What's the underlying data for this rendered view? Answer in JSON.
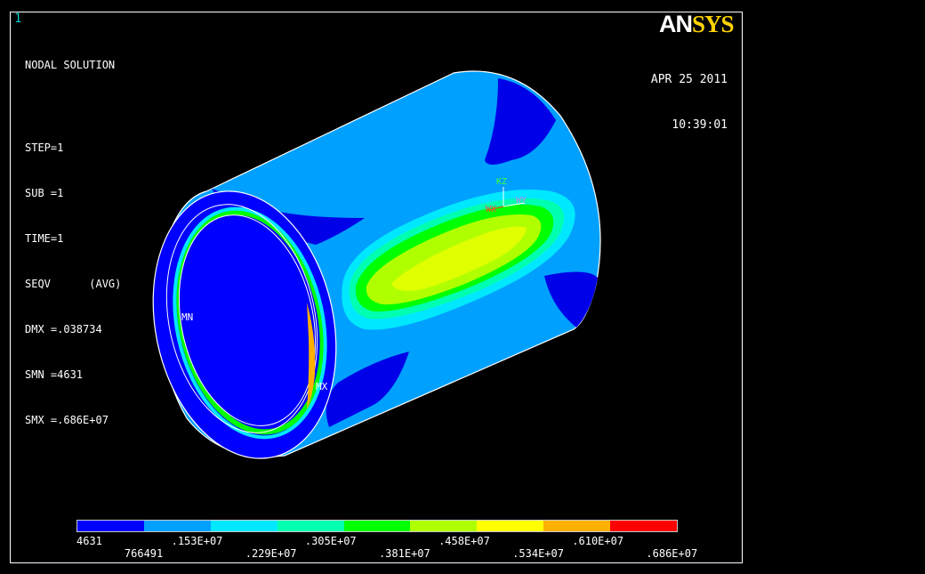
{
  "window": {
    "number": "1",
    "logo_an": "AN",
    "logo_sys": "SYS"
  },
  "info": {
    "title": "NODAL SOLUTION",
    "step": "STEP=1",
    "sub": "SUB =1",
    "time": "TIME=1",
    "seqv": "SEQV      (AVG)",
    "dmx": "DMX =.038734",
    "smn": "SMN =4631",
    "smx": "SMX =.686E+07"
  },
  "date": {
    "day": "APR 25 2011",
    "time": "10:39:01"
  },
  "markers": {
    "min": "MN",
    "max": "MX",
    "axis_z": "KZ",
    "axis_x": "WX",
    "axis_y": "WY"
  },
  "legend": {
    "colors": [
      "#0000ff",
      "#00a0ff",
      "#00e8ff",
      "#00ffb0",
      "#00ff00",
      "#b0ff00",
      "#ffff00",
      "#ffb000",
      "#ff0000"
    ],
    "labels_top": [
      "4631",
      ".153E+07",
      ".305E+07",
      ".458E+07",
      ".610E+07"
    ],
    "labels_bottom": [
      "766491",
      ".229E+07",
      ".381E+07",
      ".534E+07",
      ".686E+07"
    ]
  }
}
